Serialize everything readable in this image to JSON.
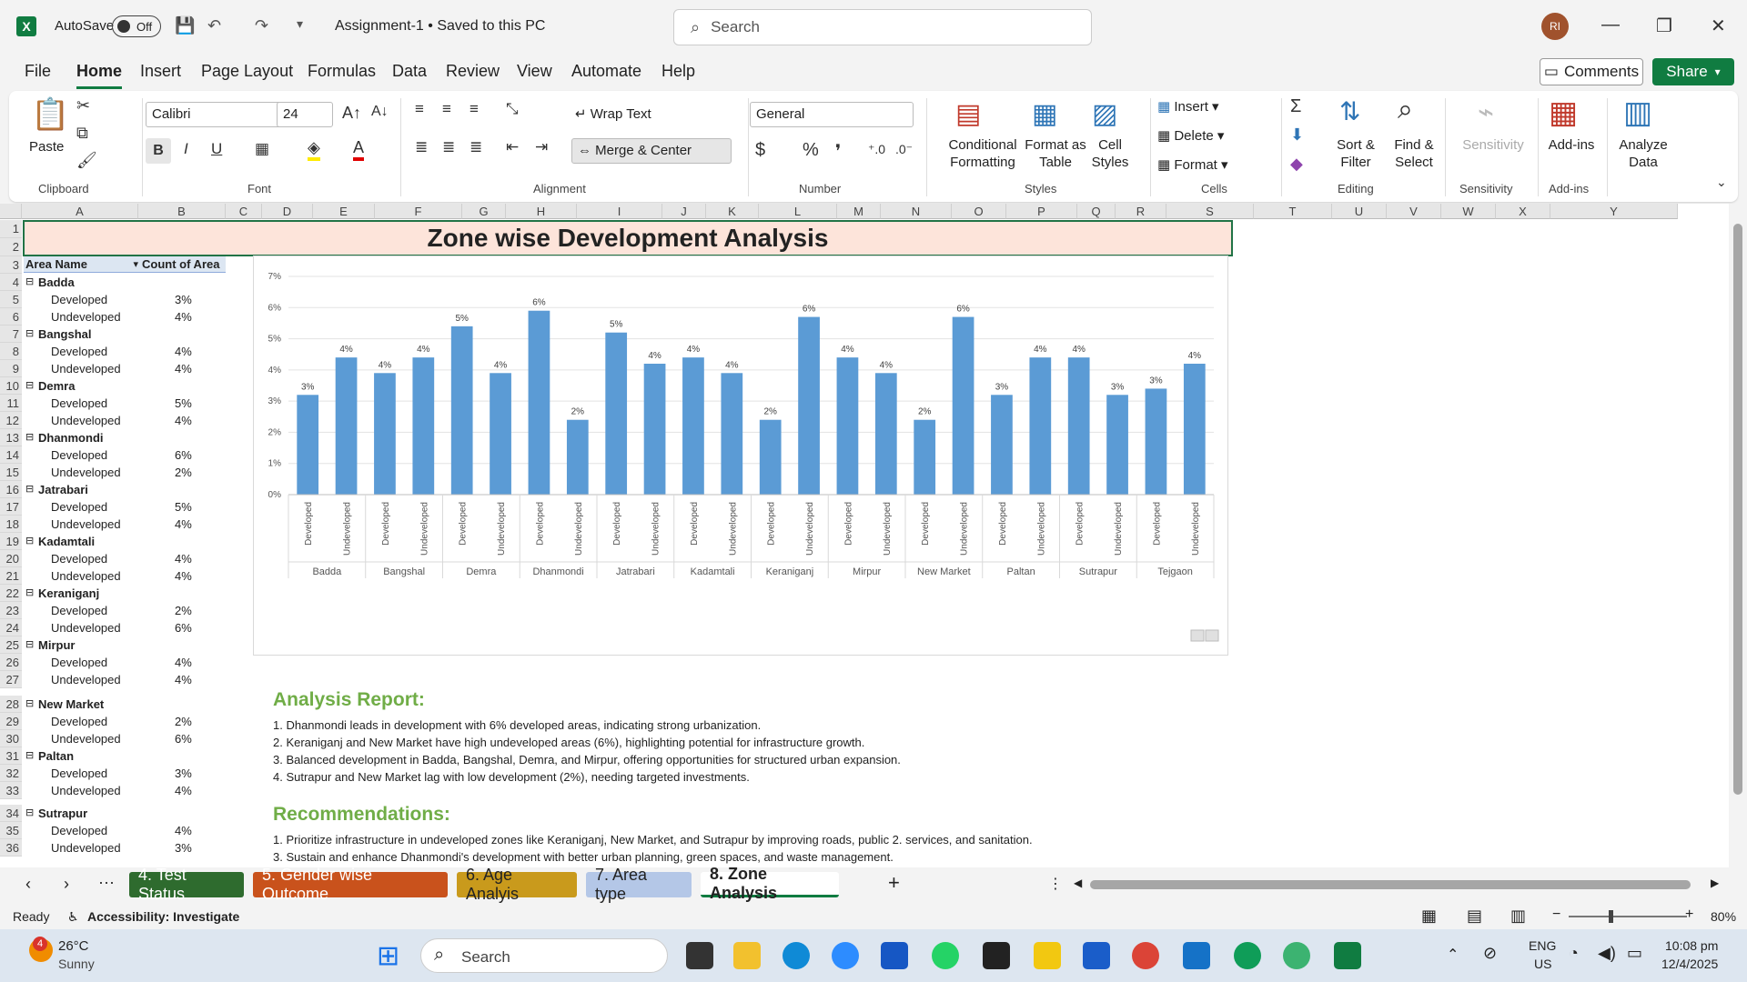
{
  "titlebar": {
    "autosave_label": "AutoSave",
    "autosave_state": "Off",
    "doc_title": "Assignment-1 • Saved to this PC",
    "search_placeholder": "Search",
    "avatar": "RI"
  },
  "menu": [
    "File",
    "Home",
    "Insert",
    "Page Layout",
    "Formulas",
    "Data",
    "Review",
    "View",
    "Automate",
    "Help"
  ],
  "menu_active": "Home",
  "comments_label": "Comments",
  "share_label": "Share",
  "ribbon": {
    "clipboard": {
      "paste": "Paste",
      "label": "Clipboard"
    },
    "font": {
      "name": "Calibri",
      "size": "24",
      "label": "Font",
      "bold": "B",
      "italic": "I",
      "underline": "U"
    },
    "alignment": {
      "wrap": "Wrap Text",
      "merge": "Merge & Center",
      "label": "Alignment"
    },
    "number": {
      "format": "General",
      "label": "Number",
      "currency": "$",
      "percent": "%",
      "comma": "❜"
    },
    "styles": {
      "conditional": "Conditional",
      "conditional2": "Formatting",
      "format_table": "Format as",
      "format_table2": "Table",
      "cell_styles": "Cell",
      "cell_styles2": "Styles",
      "label": "Styles"
    },
    "cells": {
      "insert": "Insert",
      "delete": "Delete",
      "format": "Format",
      "label": "Cells"
    },
    "editing": {
      "sort": "Sort &",
      "sort2": "Filter",
      "find": "Find &",
      "find2": "Select",
      "label": "Editing"
    },
    "sensitivity": {
      "btn": "Sensitivity",
      "label": "Sensitivity"
    },
    "addins": {
      "btn": "Add-ins",
      "label": "Add-ins"
    },
    "analyze": {
      "btn": "Analyze",
      "btn2": "Data"
    }
  },
  "columns": [
    "A",
    "B",
    "C",
    "D",
    "E",
    "F",
    "G",
    "H",
    "I",
    "J",
    "K",
    "L",
    "M",
    "N",
    "O",
    "P",
    "Q",
    "R",
    "S",
    "T",
    "U",
    "V",
    "W",
    "X",
    "Y"
  ],
  "rows": [
    "1",
    "2",
    "3",
    "4",
    "5",
    "6",
    "7",
    "8",
    "9",
    "10",
    "11",
    "12",
    "13",
    "14",
    "15",
    "16",
    "17",
    "18",
    "19",
    "20",
    "21",
    "22",
    "23",
    "24",
    "25",
    "26",
    "27",
    "28",
    "29",
    "30",
    "31",
    "32",
    "33",
    "34",
    "35",
    "36"
  ],
  "sheet_title": "Zone wise Development Analysis",
  "pivot": {
    "header_area": "Area Name",
    "header_count": "Count of Area",
    "groups": [
      {
        "name": "Badda",
        "developed": "3%",
        "undeveloped": "4%"
      },
      {
        "name": "Bangshal",
        "developed": "4%",
        "undeveloped": "4%"
      },
      {
        "name": "Demra",
        "developed": "5%",
        "undeveloped": "4%"
      },
      {
        "name": "Dhanmondi",
        "developed": "6%",
        "undeveloped": "2%"
      },
      {
        "name": "Jatrabari",
        "developed": "5%",
        "undeveloped": "4%"
      },
      {
        "name": "Kadamtali",
        "developed": "4%",
        "undeveloped": "4%"
      },
      {
        "name": "Keraniganj",
        "developed": "2%",
        "undeveloped": "6%"
      },
      {
        "name": "Mirpur",
        "developed": "4%",
        "undeveloped": "4%"
      },
      {
        "name": "New Market",
        "developed": "2%",
        "undeveloped": "6%"
      },
      {
        "name": "Paltan",
        "developed": "3%",
        "undeveloped": "4%"
      },
      {
        "name": "Sutrapur",
        "developed": "4%",
        "undeveloped": "3%"
      }
    ],
    "developed_label": "Developed",
    "undeveloped_label": "Undeveloped"
  },
  "chart_data": {
    "type": "bar",
    "categories": [
      "Badda",
      "Bangshal",
      "Demra",
      "Dhanmondi",
      "Jatrabari",
      "Kadamtali",
      "Keraniganj",
      "Mirpur",
      "New Market",
      "Paltan",
      "Sutrapur",
      "Tejgaon"
    ],
    "subcategories": [
      "Developed",
      "Undeveloped"
    ],
    "values": [
      3.2,
      4.4,
      3.9,
      4.4,
      5.4,
      3.9,
      5.9,
      2.4,
      5.2,
      4.2,
      4.4,
      3.9,
      2.4,
      5.7,
      4.4,
      3.9,
      2.4,
      5.7,
      3.2,
      4.4,
      4.4,
      3.2,
      3.4,
      4.2
    ],
    "data_labels": [
      "3%",
      "4%",
      "4%",
      "4%",
      "5%",
      "4%",
      "6%",
      "2%",
      "5%",
      "4%",
      "4%",
      "4%",
      "2%",
      "6%",
      "4%",
      "4%",
      "2%",
      "6%",
      "3%",
      "4%",
      "4%",
      "3%",
      "3%",
      "4%"
    ],
    "y_ticks": [
      "0%",
      "1%",
      "2%",
      "3%",
      "4%",
      "5%",
      "6%",
      "7%"
    ],
    "ylim": [
      0,
      7
    ],
    "grid": true,
    "bar_color": "#5b9bd5"
  },
  "analysis": {
    "title": "Analysis Report:",
    "lines": [
      "1. Dhanmondi leads in development with 6% developed areas, indicating strong urbanization.",
      "2. Keraniganj and New Market have high undeveloped areas (6%), highlighting potential for infrastructure growth.",
      "3. Balanced development in Badda, Bangshal, Demra, and Mirpur, offering opportunities for structured urban expansion.",
      "4. Sutrapur and New Market lag with low development (2%), needing targeted investments."
    ]
  },
  "recommendations": {
    "title": "Recommendations:",
    "lines": [
      "1. Prioritize infrastructure in undeveloped zones like Keraniganj, New Market, and Sutrapur by improving roads, public 2. services, and sanitation.",
      "3. Sustain and enhance Dhanmondi's development with better urban planning, green spaces, and waste management."
    ]
  },
  "tabs": [
    {
      "label": "4. Test Status",
      "color": "#2e6b2e",
      "text": "#ffffff"
    },
    {
      "label": "5. Gender wise Outcome",
      "color": "#c9521c",
      "text": "#ffffff"
    },
    {
      "label": "6. Age Analyis",
      "color": "#c99a1c",
      "text": "#222222"
    },
    {
      "label": "7. Area type",
      "color": "#b4c7e7",
      "text": "#222222"
    },
    {
      "label": "8. Zone Analysis",
      "color": "#ffffff",
      "text": "#222222"
    }
  ],
  "status": {
    "ready": "Ready",
    "accessibility": "Accessibility: Investigate",
    "zoom": "80%"
  },
  "taskbar": {
    "weather_temp": "26°C",
    "weather_desc": "Sunny",
    "weather_badge": "4",
    "search": "Search",
    "lang": "ENG",
    "region": "US",
    "time": "10:08 pm",
    "date": "12/4/2025"
  }
}
